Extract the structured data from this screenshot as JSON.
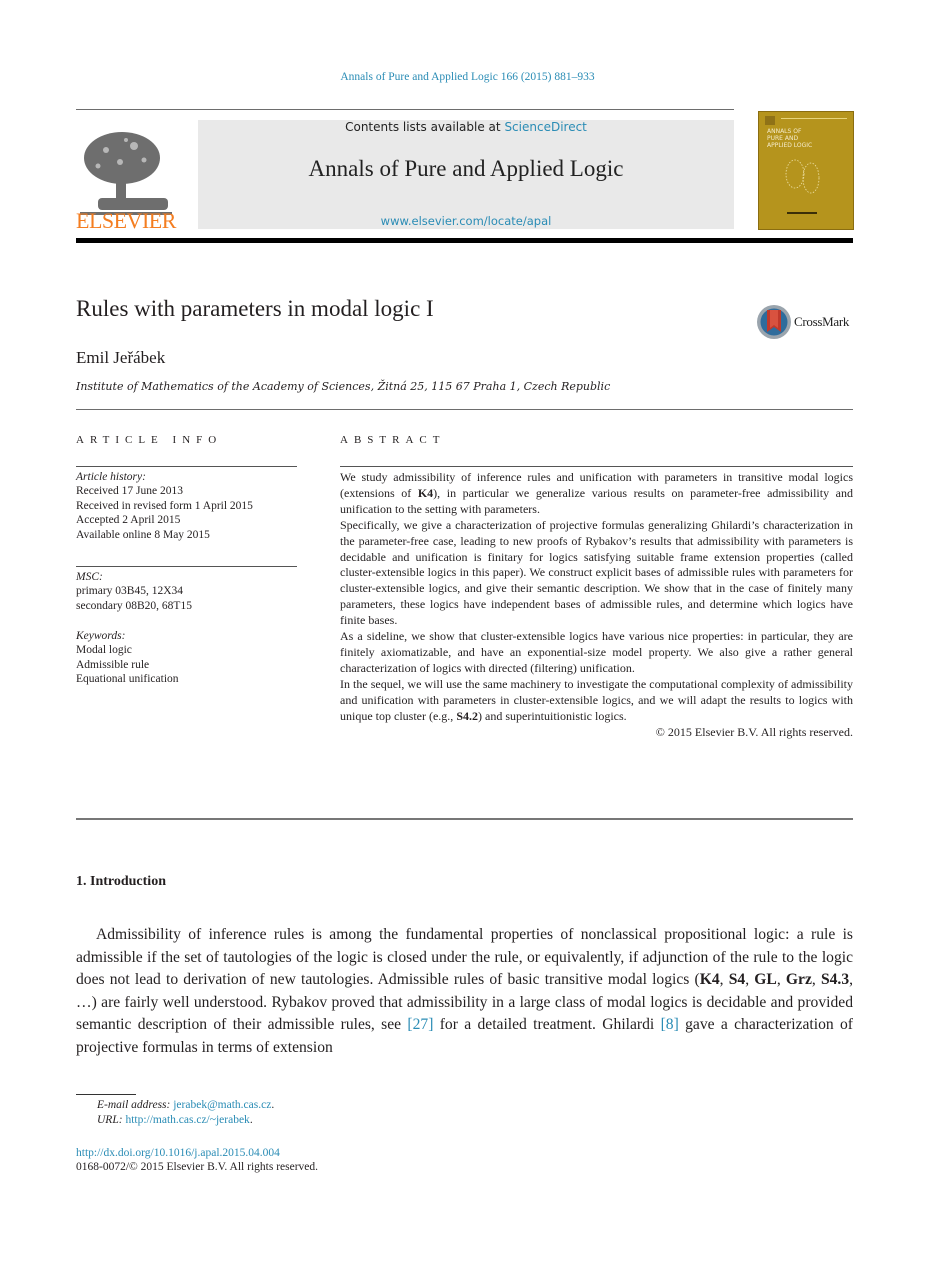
{
  "header": {
    "journal_reference": "Annals of Pure and Applied Logic 166 (2015) 881–933",
    "publisher_logo_text": "ELSEVIER",
    "contents_prefix": "Contents lists available at ",
    "contents_link": "ScienceDirect",
    "journal_title": "Annals of Pure and Applied Logic",
    "journal_url": "www.elsevier.com/locate/apal",
    "cover_title_lines": [
      "ANNALS OF",
      "PURE AND",
      "APPLIED LOGIC"
    ]
  },
  "colors": {
    "link": "#2a8cb5",
    "elsevier_orange": "#f47d20",
    "masthead_bg": "#e9e9e9",
    "cover_gold": "#b5941d",
    "crossmark_red": "#c0392b"
  },
  "article": {
    "title": "Rules with parameters in modal logic I",
    "crossmark_label": "CrossMark",
    "author": "Emil Jeřábek",
    "affiliation": "Institute of Mathematics of the Academy of Sciences, Žitná 25, 115 67 Praha 1, Czech Republic"
  },
  "article_info": {
    "heading": "ARTICLE INFO",
    "history_label": "Article history:",
    "history": [
      "Received 17 June 2013",
      "Received in revised form 1 April 2015",
      "Accepted 2 April 2015",
      "Available online 8 May 2015"
    ],
    "msc_label": "MSC:",
    "msc": [
      "primary 03B45, 12X34",
      "secondary 08B20, 68T15"
    ],
    "keywords_label": "Keywords:",
    "keywords": [
      "Modal logic",
      "Admissible rule",
      "Equational unification"
    ]
  },
  "abstract": {
    "heading": "ABSTRACT",
    "p1_a": "We study admissibility of inference rules and unification with parameters in transitive modal logics (extensions of ",
    "p1_bold": "K4",
    "p1_b": "), in particular we generalize various results on parameter-free admissibility and unification to the setting with parameters.",
    "p2": "Specifically, we give a characterization of projective formulas generalizing Ghilardi’s characterization in the parameter-free case, leading to new proofs of Rybakov’s results that admissibility with parameters is decidable and unification is finitary for logics satisfying suitable frame extension properties (called cluster-extensible logics in this paper). We construct explicit bases of admissible rules with parameters for cluster-extensible logics, and give their semantic description. We show that in the case of finitely many parameters, these logics have independent bases of admissible rules, and determine which logics have finite bases.",
    "p3": "As a sideline, we show that cluster-extensible logics have various nice properties: in particular, they are finitely axiomatizable, and have an exponential-size model property. We also give a rather general characterization of logics with directed (filtering) unification.",
    "p4_a": "In the sequel, we will use the same machinery to investigate the computational complexity of admissibility and unification with parameters in cluster-extensible logics, and we will adapt the results to logics with unique top cluster (e.g., ",
    "p4_bold": "S4.2",
    "p4_b": ") and superintuitionistic logics.",
    "copyright": "© 2015 Elsevier B.V. All rights reserved."
  },
  "introduction": {
    "heading": "1. Introduction",
    "t1": "Admissibility of inference rules is among the fundamental properties of nonclassical propositional logic: a rule is admissible if the set of tautologies of the logic is closed under the rule, or equivalently, if adjunction of the rule to the logic does not lead to derivation of new tautologies. Admissible rules of basic transitive modal logics (",
    "logics": [
      "K4",
      "S4",
      "GL",
      "Grz",
      "S4.3"
    ],
    "t2": ", …) are fairly well understood. Rybakov proved that admissibility in a large class of modal logics is decidable and provided semantic description of their admissible rules, see ",
    "ref1": "[27]",
    "t3": " for a detailed treatment. Ghilardi ",
    "ref2": "[8]",
    "t4": " gave a characterization of projective formulas in terms of extension"
  },
  "footnotes": {
    "email_label": "E-mail address: ",
    "email": "jerabek@math.cas.cz",
    "url_label": "URL: ",
    "url": "http://math.cas.cz/~jerabek",
    "doi": "http://dx.doi.org/10.1016/j.apal.2015.04.004",
    "issn_line": "0168-0072/© 2015 Elsevier B.V. All rights reserved."
  }
}
